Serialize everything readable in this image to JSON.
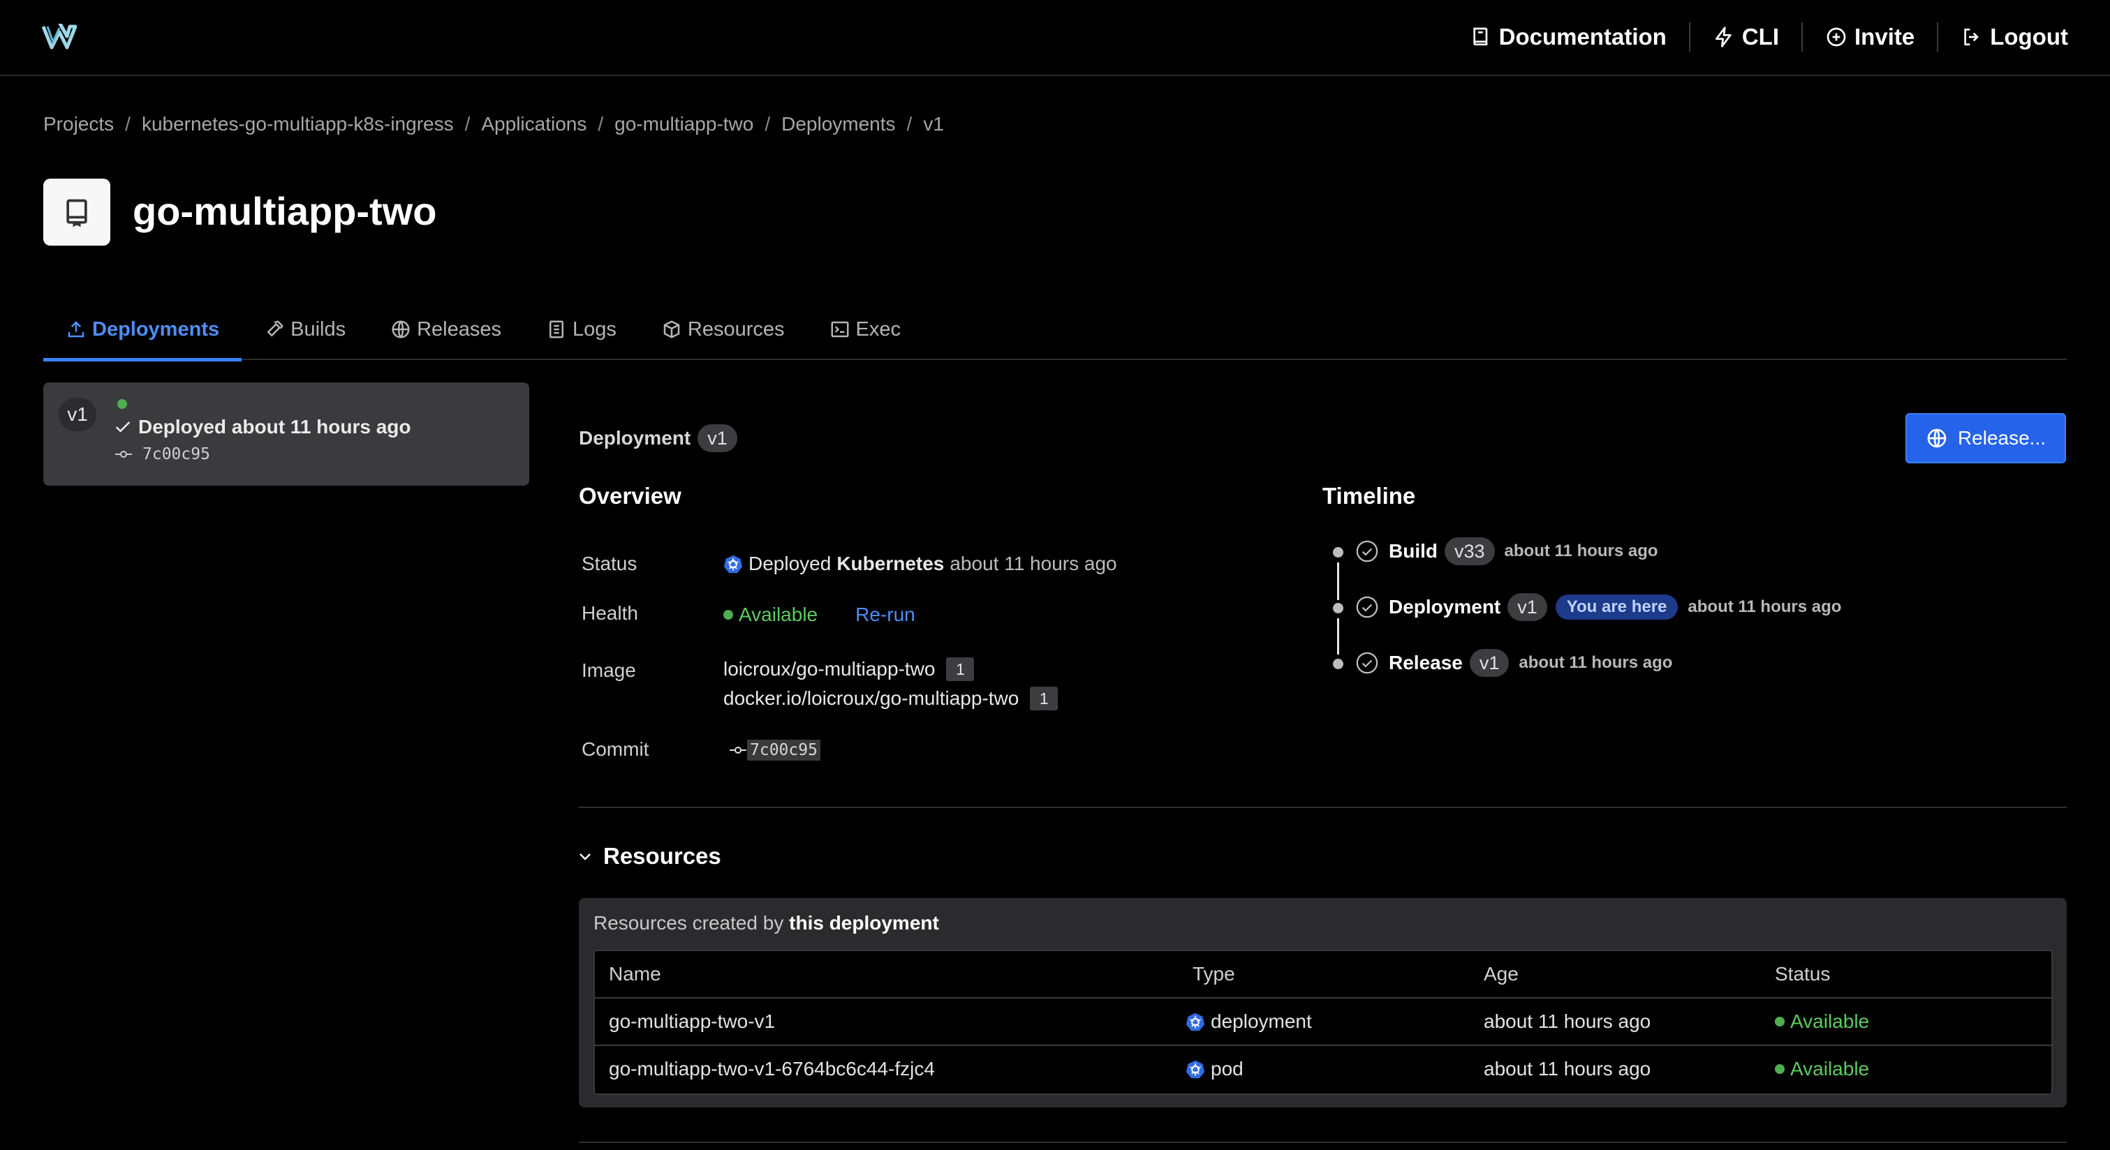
{
  "header": {
    "nav": [
      {
        "label": "Documentation",
        "icon": "book-icon"
      },
      {
        "label": "CLI",
        "icon": "lightning-icon"
      },
      {
        "label": "Invite",
        "icon": "plus-circle-icon"
      },
      {
        "label": "Logout",
        "icon": "logout-icon"
      }
    ]
  },
  "breadcrumb": [
    "Projects",
    "kubernetes-go-multiapp-k8s-ingress",
    "Applications",
    "go-multiapp-two",
    "Deployments",
    "v1"
  ],
  "page": {
    "title": "go-multiapp-two"
  },
  "tabs": [
    {
      "label": "Deployments",
      "icon": "upload-icon",
      "active": true
    },
    {
      "label": "Builds",
      "icon": "hammer-icon"
    },
    {
      "label": "Releases",
      "icon": "globe-icon"
    },
    {
      "label": "Logs",
      "icon": "document-icon"
    },
    {
      "label": "Resources",
      "icon": "cube-icon"
    },
    {
      "label": "Exec",
      "icon": "terminal-icon"
    }
  ],
  "sidebar": {
    "deployment": {
      "version": "v1",
      "status": "Deployed about 11 hours ago",
      "commit": "7c00c95"
    }
  },
  "main": {
    "heading": "Deployment",
    "version": "v1",
    "release_button": "Release...",
    "overview": {
      "title": "Overview",
      "status_label": "Status",
      "status_prefix": "Deployed",
      "status_target": "Kubernetes",
      "status_time": "about 11 hours ago",
      "health_label": "Health",
      "health_value": "Available",
      "rerun_label": "Re-run",
      "image_label": "Image",
      "images": [
        {
          "name": "loicroux/go-multiapp-two",
          "count": "1"
        },
        {
          "name": "docker.io/loicroux/go-multiapp-two",
          "count": "1"
        }
      ],
      "commit_label": "Commit",
      "commit": "7c00c95"
    },
    "timeline": {
      "title": "Timeline",
      "items": [
        {
          "name": "Build",
          "version": "v33",
          "time": "about 11 hours ago"
        },
        {
          "name": "Deployment",
          "version": "v1",
          "badge": "You are here",
          "time": "about 11 hours ago"
        },
        {
          "name": "Release",
          "version": "v1",
          "time": "about 11 hours ago"
        }
      ]
    },
    "resources": {
      "title": "Resources",
      "caption_prefix": "Resources created by",
      "caption_bold": "this deployment",
      "columns": [
        "Name",
        "Type",
        "Age",
        "Status"
      ],
      "rows": [
        {
          "name": "go-multiapp-two-v1",
          "type": "deployment",
          "age": "about 11 hours ago",
          "status": "Available"
        },
        {
          "name": "go-multiapp-two-v1-6764bc6c44-fzjc4",
          "type": "pod",
          "age": "about 11 hours ago",
          "status": "Available"
        }
      ]
    }
  },
  "colors": {
    "accent": "#2563eb",
    "link": "#4f8ef7",
    "success": "#4caf50",
    "background": "#000000"
  }
}
